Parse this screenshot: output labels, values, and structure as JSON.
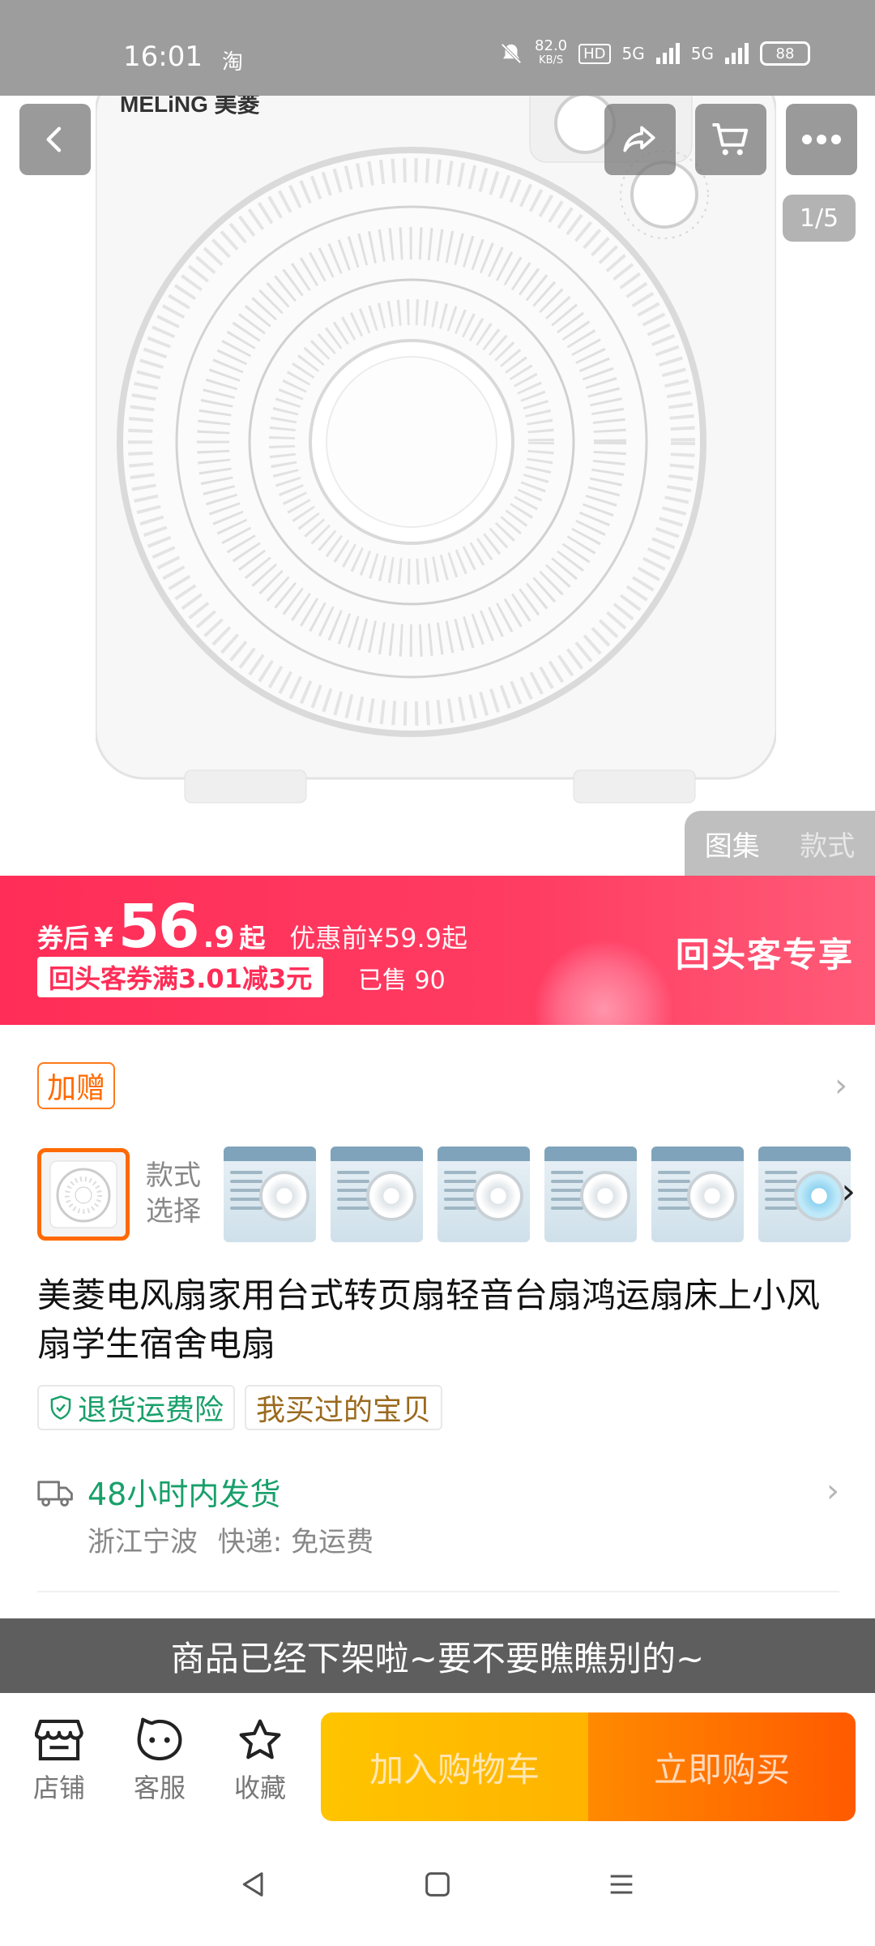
{
  "status_bar": {
    "time": "16:01",
    "app_icon": "淘",
    "speed_value": "82.0",
    "speed_unit": "KB/S",
    "hd": "HD",
    "net1": "5G",
    "net2": "5G",
    "battery": "88"
  },
  "header": {
    "back_icon": "chevron-left-icon",
    "share_icon": "share-icon",
    "cart_icon": "cart-icon",
    "more_icon": "more-dots-icon",
    "image_counter": "1/5",
    "gallery_tabs": [
      "图集",
      "款式"
    ]
  },
  "hero": {
    "brand": "MELiNG 美菱"
  },
  "promo": {
    "after_coupon_label": "券后",
    "currency": "¥",
    "price_int": "56",
    "price_dec": ".9",
    "price_suffix": "起",
    "original_price": "优惠前¥59.9起",
    "coupon": "回头客券满3.01减3元",
    "sold": "已售 90",
    "returner_label": "回头客专享"
  },
  "gift": {
    "label": "加赠"
  },
  "styles": {
    "label_line1": "款式",
    "label_line2": "选择",
    "thumb_count": 6
  },
  "product": {
    "title": "美菱电风扇家用台式转页扇轻音台扇鸿运扇床上小风扇学生宿舍电扇",
    "tags": [
      "退货运费险",
      "我买过的宝贝"
    ]
  },
  "shipping": {
    "title": "48小时内发货",
    "origin": "浙江宁波",
    "express": "快递: 免运费"
  },
  "notice": "商品已经下架啦~要不要瞧瞧别的~",
  "bottom_bar": {
    "shop": "店铺",
    "service": "客服",
    "favorite": "收藏",
    "add_to_cart": "加入购物车",
    "buy_now": "立即购买"
  },
  "colors": {
    "promo_red": "#ff2d57",
    "accent_orange": "#ff6a00",
    "green": "#18a06a",
    "notice_bg": "#5e5e5e"
  }
}
